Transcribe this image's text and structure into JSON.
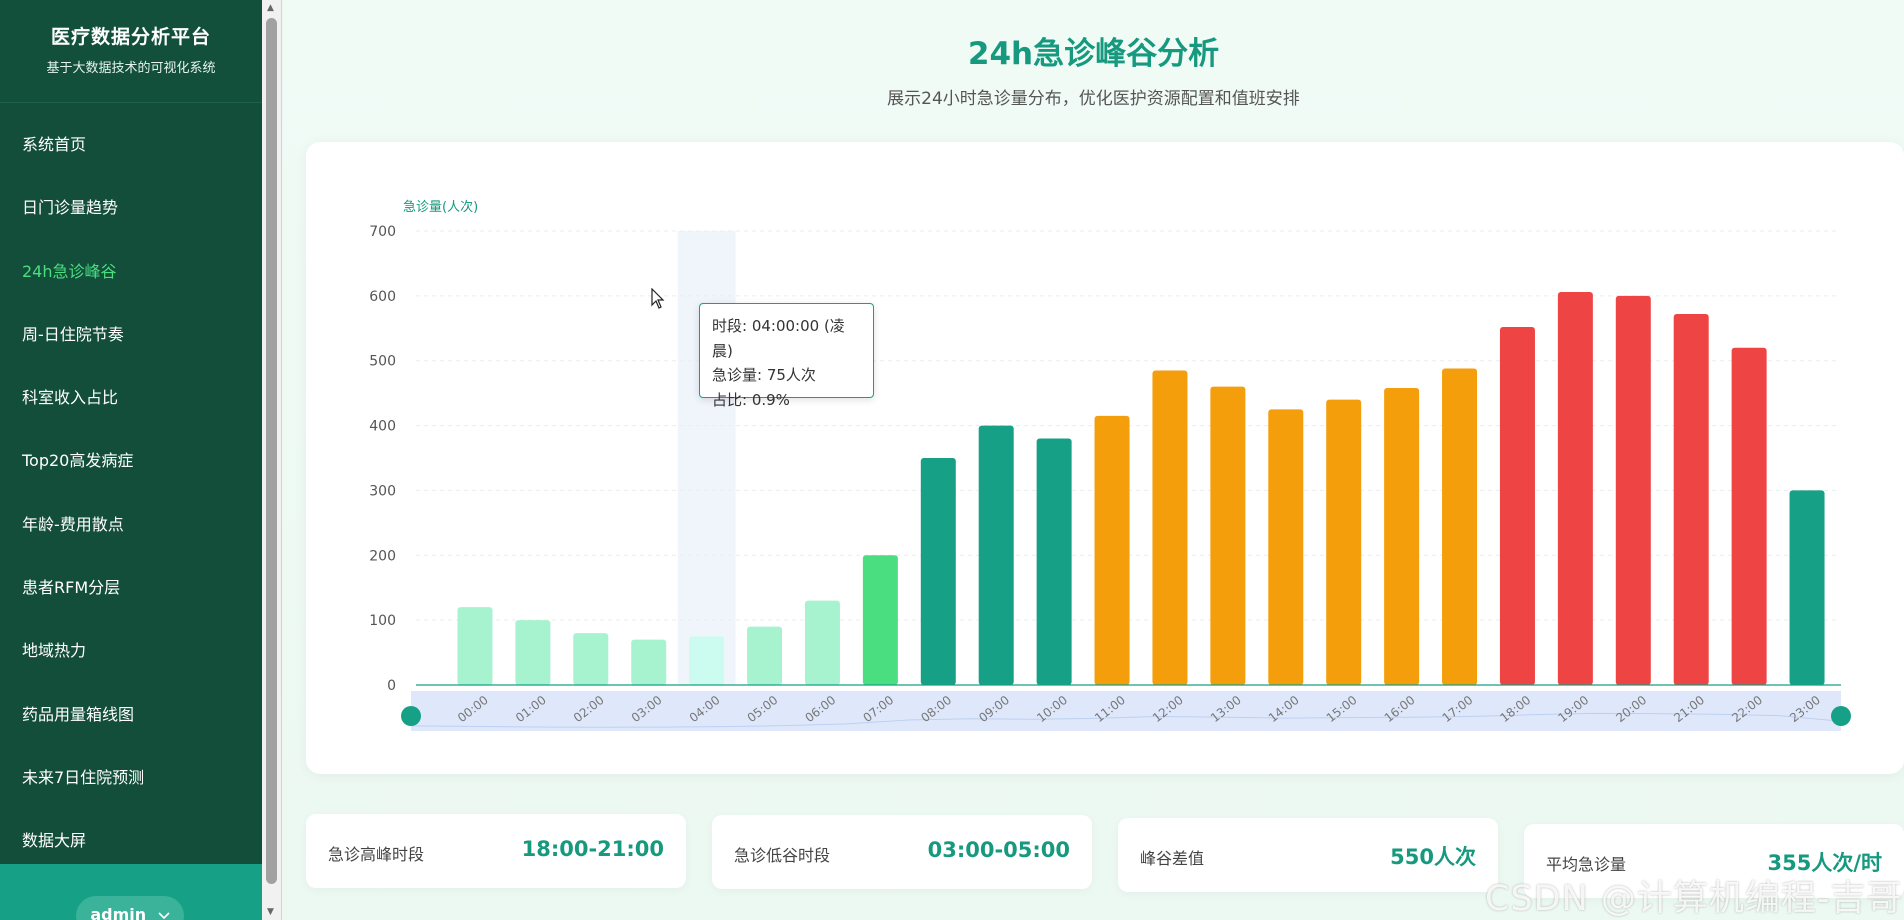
{
  "sidebar": {
    "brand_title": "医疗数据分析平台",
    "brand_subtitle": "基于大数据技术的可视化系统",
    "items": [
      {
        "label": "系统首页"
      },
      {
        "label": "日门诊量趋势"
      },
      {
        "label": "24h急诊峰谷",
        "active": true
      },
      {
        "label": "周-日住院节奏"
      },
      {
        "label": "科室收入占比"
      },
      {
        "label": "Top20高发病症"
      },
      {
        "label": "年龄-费用散点"
      },
      {
        "label": "患者RFM分层"
      },
      {
        "label": "地域热力"
      },
      {
        "label": "药品用量箱线图"
      },
      {
        "label": "未来7日住院预测"
      },
      {
        "label": "数据大屏"
      }
    ],
    "user": "admin",
    "user_icon": "chevron-down-icon"
  },
  "page": {
    "title": "24h急诊峰谷分析",
    "subtitle": "展示24小时急诊量分布，优化医护资源配置和值班安排"
  },
  "tooltip": {
    "line1": "时段: 04:00:00 (凌晨)",
    "line2": "急诊量: 75人次",
    "line3": "占比: 0.9%"
  },
  "chart_data": {
    "type": "bar",
    "ylabel": "急诊量(人次)",
    "ylim": [
      0,
      700
    ],
    "yticks": [
      0,
      100,
      200,
      300,
      400,
      500,
      600,
      700
    ],
    "grid": true,
    "categories": [
      "00:00",
      "01:00",
      "02:00",
      "03:00",
      "04:00",
      "05:00",
      "06:00",
      "07:00",
      "08:00",
      "09:00",
      "10:00",
      "11:00",
      "12:00",
      "13:00",
      "14:00",
      "15:00",
      "16:00",
      "17:00",
      "18:00",
      "19:00",
      "20:00",
      "21:00",
      "22:00",
      "23:00"
    ],
    "values": [
      120,
      100,
      80,
      70,
      75,
      90,
      130,
      200,
      350,
      400,
      380,
      415,
      485,
      460,
      425,
      440,
      458,
      488,
      552,
      606,
      600,
      572,
      520,
      300
    ],
    "highlighted_index": 4,
    "colors": {
      "low": "#a7f3d0",
      "rising": "#4ade80",
      "normal": "#16a085",
      "busy": "#f59e0b",
      "peak": "#ef4444",
      "hover": "#ccfbef"
    },
    "data_zoom": true
  },
  "stats": [
    {
      "label": "急诊高峰时段",
      "value": "18:00-21:00"
    },
    {
      "label": "急诊低谷时段",
      "value": "03:00-05:00"
    },
    {
      "label": "峰谷差值",
      "value": "550人次"
    },
    {
      "label": "平均急诊量",
      "value": "355人次/时"
    }
  ],
  "watermark": "CSDN @计算机编程-吉哥"
}
